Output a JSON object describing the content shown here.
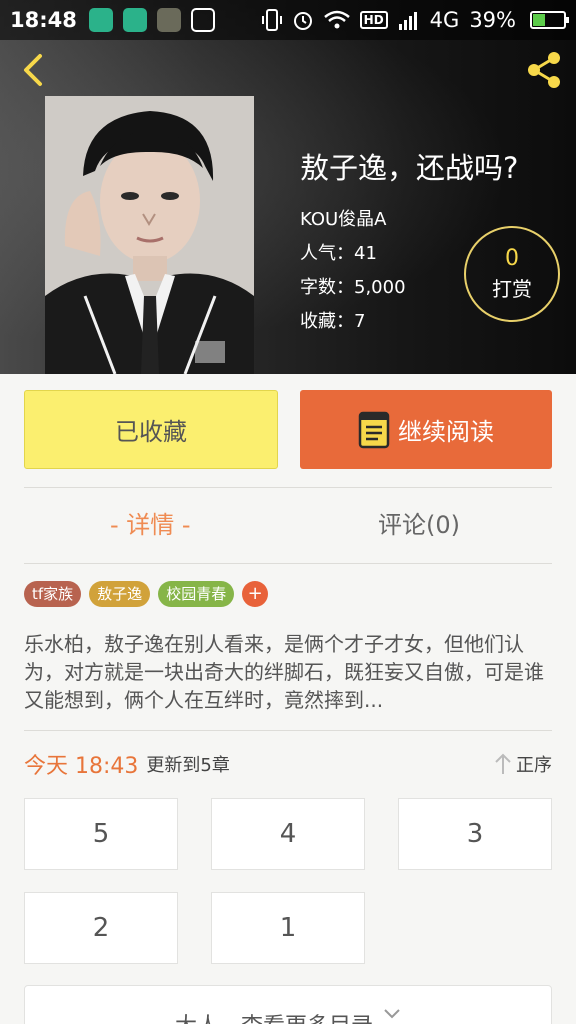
{
  "status_bar": {
    "time": "18:48",
    "network": "4G",
    "hd": "HD",
    "battery_percent": "39%",
    "battery_level": 0.39
  },
  "book": {
    "title": "敖子逸，还战吗?",
    "author": "KOU俊晶A",
    "popularity": "人气：41",
    "word_count": "字数：5,000",
    "favorites": "收藏：7"
  },
  "reward": {
    "count": "0",
    "label": "打赏"
  },
  "actions": {
    "collected_label": "已收藏",
    "continue_label": "继续阅读"
  },
  "tabs": {
    "detail": "- 详情 -",
    "comments": "评论(0)"
  },
  "tags": [
    {
      "label": "tf家族",
      "color": "#b8634f"
    },
    {
      "label": "敖子逸",
      "color": "#d1a23a"
    },
    {
      "label": "校园青春",
      "color": "#86b548"
    },
    {
      "label": "+",
      "color": "#e8623a"
    }
  ],
  "description": "乐水柏，敖子逸在别人看来，是俩个才子才女，但他们认为，对方就是一块出奇大的绊脚石，既狂妄又自傲，可是谁又能想到，俩个人在互绊时，竟然摔到...",
  "update": {
    "time": "今天 18:43",
    "text": "更新到5章",
    "sort_label": "正序"
  },
  "chapters": [
    "5",
    "4",
    "3",
    "2",
    "1"
  ],
  "more_button": {
    "label": "大人，查看更多目录"
  },
  "colors": {
    "accent": "#e86a3a",
    "collected_bg": "#fbef6f"
  }
}
